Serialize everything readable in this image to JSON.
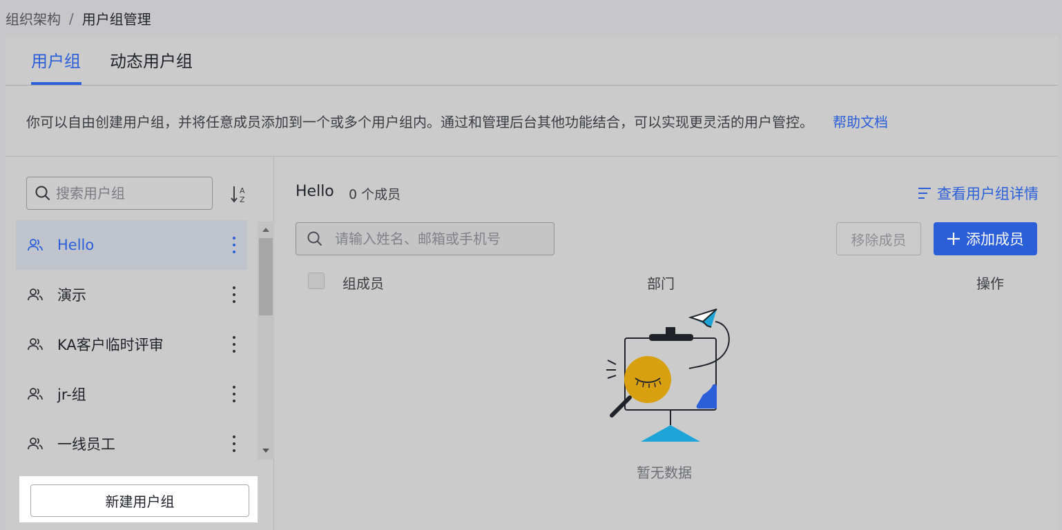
{
  "breadcrumb": {
    "parent": "组织架构",
    "separator": "/",
    "current": "用户组管理"
  },
  "tabs": [
    {
      "label": "用户组",
      "active": true
    },
    {
      "label": "动态用户组",
      "active": false
    }
  ],
  "description": {
    "text": "你可以自由创建用户组，并将任意成员添加到一个或多个用户组内。通过和管理后台其他功能结合，可以实现更灵活的用户管控。",
    "help_link": "帮助文档"
  },
  "sidebar": {
    "search_placeholder": "搜索用户组",
    "sort_icon": "sort-az-icon",
    "groups": [
      {
        "label": "Hello",
        "selected": true
      },
      {
        "label": "演示",
        "selected": false
      },
      {
        "label": "KA客户临时评审",
        "selected": false
      },
      {
        "label": "jr-组",
        "selected": false
      },
      {
        "label": "一线员工",
        "selected": false
      }
    ],
    "new_group_label": "新建用户组"
  },
  "detail": {
    "group_name": "Hello",
    "member_count": "0 个成员",
    "view_details_label": "查看用户组详情",
    "search_placeholder": "请输入姓名、邮箱或手机号",
    "remove_label": "移除成员",
    "add_label": "添加成员",
    "columns": [
      "组成员",
      "部门",
      "操作"
    ],
    "empty_text": "暂无数据"
  },
  "colors": {
    "accent": "#2b5fd9",
    "background": "#c7c7c9"
  }
}
